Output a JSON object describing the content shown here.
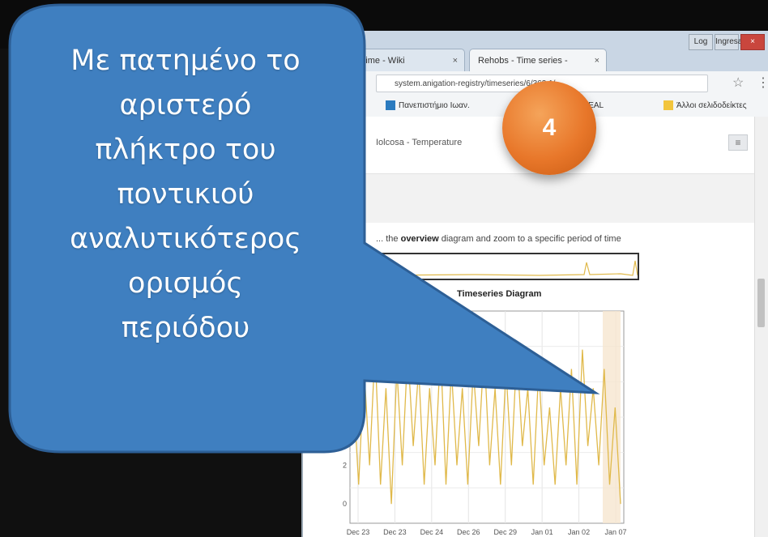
{
  "browser": {
    "tabs": [
      {
        "label": "Time - Wiki",
        "close": "×"
      },
      {
        "label": "Rehobs - Time series -",
        "close": "×"
      }
    ],
    "window_controls": {
      "minimize": "Log",
      "maximize": "Ingresar",
      "close": "×"
    },
    "url": "system.anigation-registry/timeseries/6/363.1/",
    "bookmarks": [
      {
        "label": "Πανεπιστήμιο Ιωαν.",
        "color": "#2b7bbf"
      },
      {
        "label": "REAL",
        "color": "#3aa34a"
      },
      {
        "label": "Άλλοι σελιδοδείκτες",
        "color": "#f2c53d"
      }
    ]
  },
  "page": {
    "menu_icon": "≡",
    "panel_title": "Iolcosa - Temperature",
    "instruction_prefix": "... the",
    "instruction_bold": "overview",
    "instruction_suffix": "diagram and zoom to a specific period of time",
    "chart_title": "Timeseries Diagram"
  },
  "badge": {
    "number": "4"
  },
  "callout": {
    "lines": [
      "Με πατημένο το",
      "αριστερό",
      "πλήκτρο του",
      "ποντικιού",
      "αναλυτικότερος",
      "ορισμός",
      "περιόδου"
    ]
  },
  "chart_data": {
    "type": "line",
    "title": "Timeseries Diagram",
    "x_ticks": [
      "Dec 23",
      "Dec 23",
      "Dec 24",
      "Dec 26",
      "Dec 29",
      "Jan 01",
      "Jan 02",
      "Jan 07"
    ],
    "y_ticks": [
      "2",
      "0"
    ],
    "color": "#e0b94a",
    "series": [
      {
        "values": [
          6,
          1,
          7,
          2,
          8,
          1,
          6,
          0,
          7,
          2,
          8,
          3,
          7,
          1,
          6,
          2,
          8,
          1,
          7,
          2,
          6,
          1,
          7,
          3,
          8,
          2,
          6,
          1,
          7,
          2,
          8,
          3,
          6,
          1,
          7,
          2,
          5,
          1,
          6,
          2,
          7,
          1,
          8,
          3,
          6,
          2,
          7,
          1,
          5,
          0
        ]
      }
    ],
    "ylim": [
      -1,
      10
    ]
  },
  "colors": {
    "callout": "#3f7fc0",
    "callout_border": "#2d5f96",
    "badge": "#e8772a"
  }
}
